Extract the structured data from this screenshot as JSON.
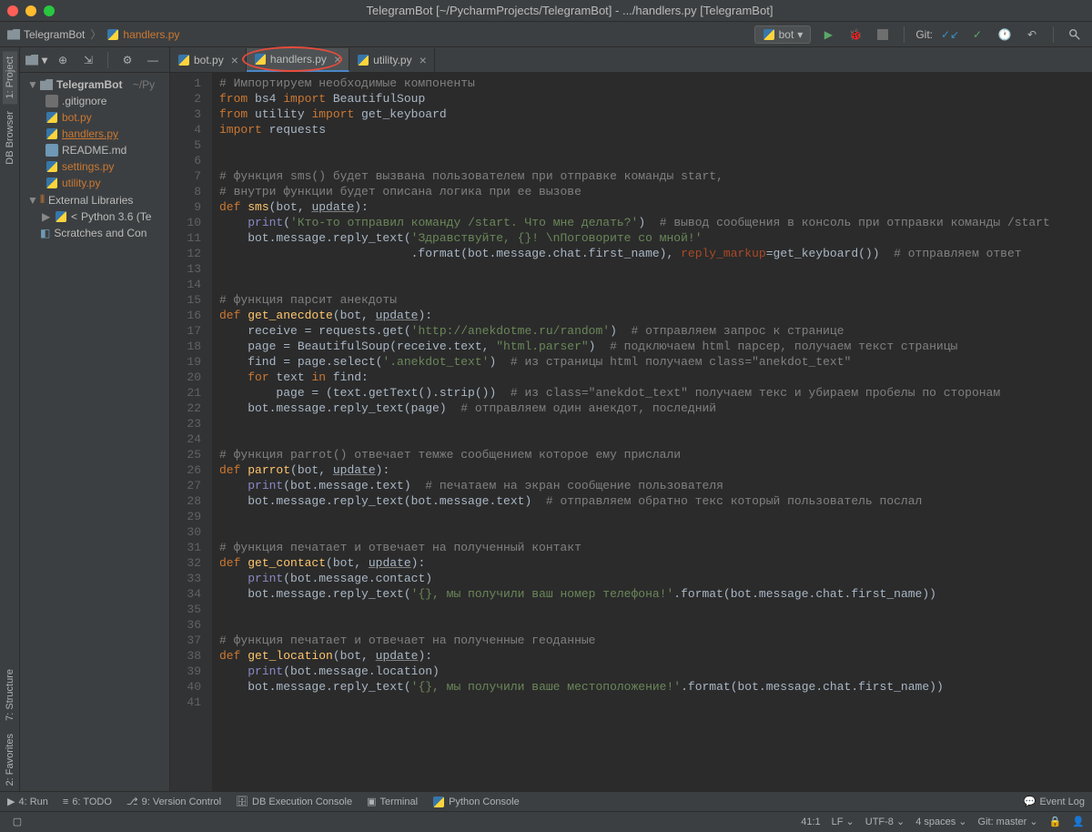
{
  "window": {
    "title": "TelegramBot [~/PycharmProjects/TelegramBot] - .../handlers.py [TelegramBot]"
  },
  "breadcrumb": {
    "project": "TelegramBot",
    "file": "handlers.py"
  },
  "runconfig": {
    "label": "bot"
  },
  "git_label": "Git:",
  "project_tree": {
    "root": "TelegramBot",
    "root_path": "~/Py",
    "files": [
      {
        "name": ".gitignore",
        "kind": "txt"
      },
      {
        "name": "bot.py",
        "kind": "py"
      },
      {
        "name": "handlers.py",
        "kind": "py",
        "selected": true
      },
      {
        "name": "README.md",
        "kind": "md"
      },
      {
        "name": "settings.py",
        "kind": "py"
      },
      {
        "name": "utility.py",
        "kind": "py"
      }
    ],
    "external": "External Libraries",
    "python": "Python 3.6 (Te",
    "scratch": "Scratches and Con"
  },
  "tabs": [
    {
      "label": "bot.py"
    },
    {
      "label": "handlers.py",
      "active": true,
      "highlight": true
    },
    {
      "label": "utility.py"
    }
  ],
  "code_lines": [
    "# Импортируем необходимые компоненты",
    "from bs4 import BeautifulSoup",
    "from utility import get_keyboard",
    "import requests",
    "",
    "",
    "# функция sms() будет вызвана пользователем при отправке команды start,",
    "# внутри функции будет описана логика при ее вызове",
    "def sms(bot, update):",
    "    print('Кто-то отправил команду /start. Что мне делать?')  # вывод сообщения в консоль при отправки команды /start",
    "    bot.message.reply_text('Здравствуйте, {}! \\nПоговорите со мной!'",
    "                           .format(bot.message.chat.first_name), reply_markup=get_keyboard())  # отправляем ответ",
    "",
    "",
    "# функция парсит анекдоты",
    "def get_anecdote(bot, update):",
    "    receive = requests.get('http://anekdotme.ru/random')  # отправляем запрос к странице",
    "    page = BeautifulSoup(receive.text, \"html.parser\")  # подключаем html парсер, получаем текст страницы",
    "    find = page.select('.anekdot_text')  # из страницы html получаем class=\"anekdot_text\"",
    "    for text in find:",
    "        page = (text.getText().strip())  # из class=\"anekdot_text\" получаем текс и убираем пробелы по сторонам",
    "    bot.message.reply_text(page)  # отправляем один анекдот, последний",
    "",
    "",
    "# функция parrot() отвечает темже сообщением которое ему прислали",
    "def parrot(bot, update):",
    "    print(bot.message.text)  # печатаем на экран сообщение пользователя",
    "    bot.message.reply_text(bot.message.text)  # отправляем обратно текс который пользователь послал",
    "",
    "",
    "# функция печатает и отвечает на полученный контакт",
    "def get_contact(bot, update):",
    "    print(bot.message.contact)",
    "    bot.message.reply_text('{}, мы получили ваш номер телефона!'.format(bot.message.chat.first_name))",
    "",
    "",
    "# функция печатает и отвечает на полученные геоданные",
    "def get_location(bot, update):",
    "    print(bot.message.location)",
    "    bot.message.reply_text('{}, мы получили ваше местоположение!'.format(bot.message.chat.first_name))",
    ""
  ],
  "bottom_tools": {
    "run": "4: Run",
    "todo": "6: TODO",
    "vcs": "9: Version Control",
    "db": "DB Execution Console",
    "terminal": "Terminal",
    "pyconsole": "Python Console",
    "eventlog": "Event Log"
  },
  "status": {
    "position": "41:1",
    "lineend": "LF",
    "encoding": "UTF-8",
    "indent": "4 spaces",
    "git": "Git: master"
  },
  "left_tabs": {
    "project": "1: Project",
    "db": "DB Browser",
    "structure": "7: Structure",
    "favorites": "2: Favorites"
  }
}
